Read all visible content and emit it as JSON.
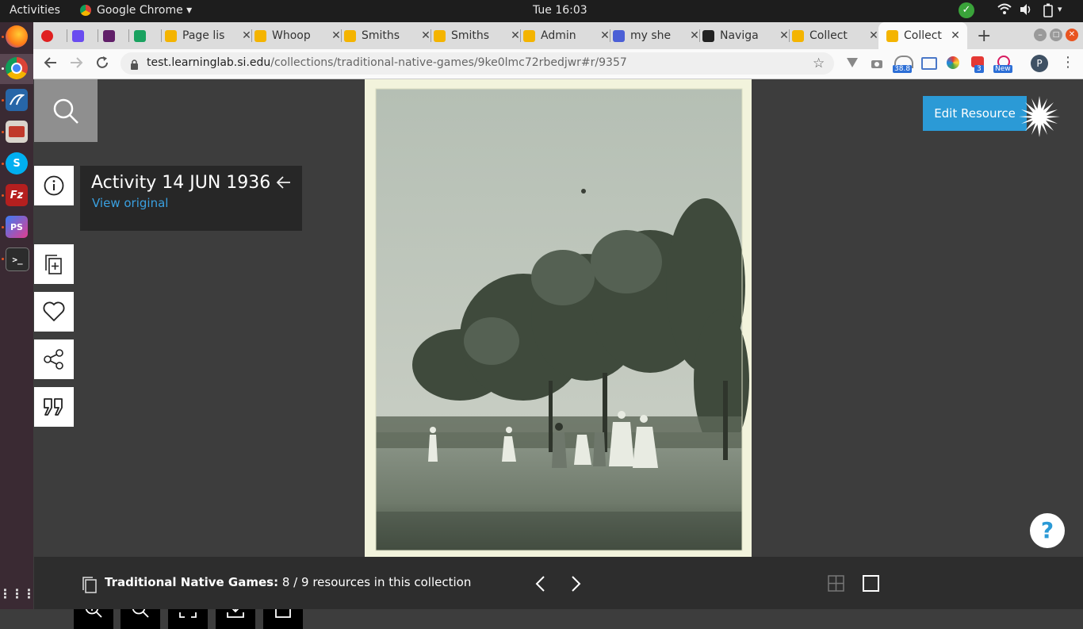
{
  "system": {
    "activities": "Activities",
    "app_name": "Google Chrome",
    "clock": "Tue 16:03",
    "ext_badge_1": "38.8",
    "ext_badge_2": "3",
    "ext_badge_3": "New",
    "profile": "P"
  },
  "tabs": [
    {
      "label": "",
      "color": "#e02020"
    },
    {
      "label": "",
      "color": "#6a4cf0"
    },
    {
      "label": "",
      "color": "#611f69"
    },
    {
      "label": "",
      "color": "#1aa260"
    },
    {
      "label": "Page lis",
      "color": "#f4b400"
    },
    {
      "label": "Whoop",
      "color": "#f4b400"
    },
    {
      "label": "Smiths",
      "color": "#f4b400"
    },
    {
      "label": "Smiths",
      "color": "#f4b400"
    },
    {
      "label": "Admin",
      "color": "#f4b400"
    },
    {
      "label": "my she",
      "color": "#4b5fd6"
    },
    {
      "label": "Naviga",
      "color": "#222222"
    },
    {
      "label": "Collect",
      "color": "#f4b400"
    },
    {
      "label": "Collect",
      "color": "#f4b400"
    }
  ],
  "address": {
    "host": "test.learninglab.si.edu",
    "path": "/collections/traditional-native-games/9ke0lmc72rbedjwr#r/9357"
  },
  "resource": {
    "title": "Activity 14 JUN 1936",
    "view_original": "View original",
    "edit_button": "Edit Resource",
    "help": "?"
  },
  "collection": {
    "name": "Traditional Native Games:",
    "position": "8 / 9 resources in this collection"
  },
  "colors": {
    "accent": "#2b9ad6",
    "link": "#3aa0e0",
    "panel": "#272727",
    "page_bg": "#3d3d3d"
  }
}
